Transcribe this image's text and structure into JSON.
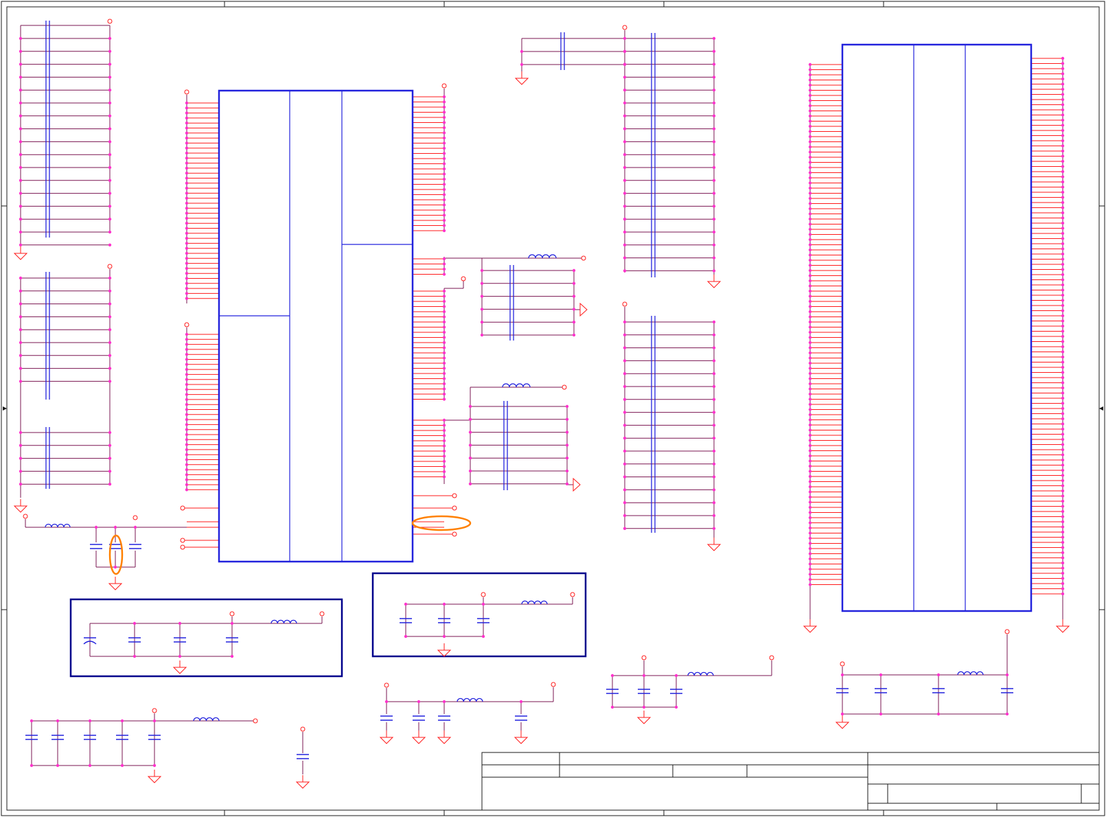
{
  "colors": {
    "background": "#ffffff",
    "border": "#1a1a1a",
    "wire": "#7a1550",
    "pin": "#ff1a1a",
    "junction": "#ff33cc",
    "component": "#2222dd",
    "frame": "#00008b",
    "highlight": "#ff8000"
  },
  "components": {
    "ic_package_blocks": 2,
    "highlighted_items": 2
  }
}
